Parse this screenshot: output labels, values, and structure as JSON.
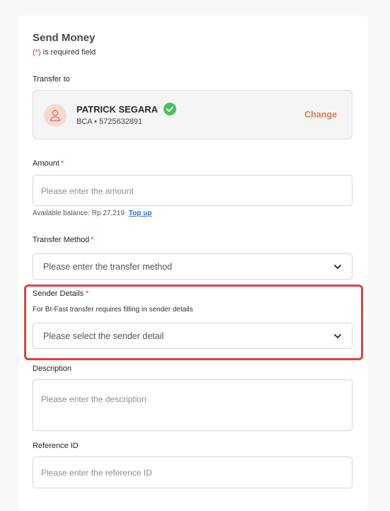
{
  "page": {
    "title": "Send Money",
    "required_note_star": "(*)",
    "required_note_text": " is required field"
  },
  "transfer_to": {
    "label": "Transfer to",
    "name": "PATRICK SEGARA",
    "bank": "BCA",
    "separator": " • ",
    "account": "5725632891",
    "change_label": "Change"
  },
  "amount": {
    "label": "Amount",
    "required_mark": "*",
    "placeholder": "Please enter the amount",
    "balance_text": "Available balance: Rp 27,219",
    "topup_label": "Top up"
  },
  "transfer_method": {
    "label": "Transfer Method",
    "required_mark": "*",
    "placeholder": "Please enter the transfer method"
  },
  "sender_details": {
    "label": "Sender Details",
    "required_mark": "*",
    "helper": "For BI-Fast transfer requires filling in sender details",
    "placeholder": "Please select the sender detail",
    "highlight_color": "#e5403b"
  },
  "description": {
    "label": "Description",
    "placeholder": "Please enter the description"
  },
  "reference_id": {
    "label": "Reference ID",
    "placeholder": "Please enter the reference ID"
  },
  "colors": {
    "accent": "#e07b49",
    "link": "#2f6fd6",
    "verified": "#4cc05f",
    "required": "#d93a34"
  }
}
